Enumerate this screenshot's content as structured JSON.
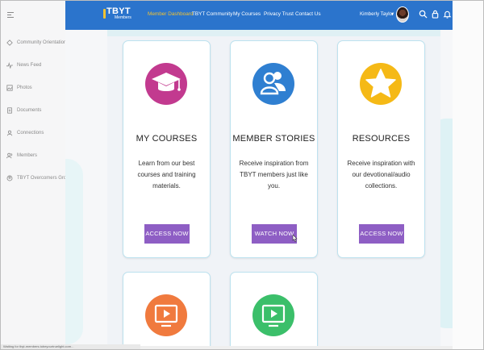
{
  "brand": {
    "name": "TBYT",
    "subtitle": "Members",
    "accent": "#f1c232"
  },
  "topbar": {
    "color": "#2b74cc",
    "nav": [
      {
        "label": "Member Dashboard",
        "active": true
      },
      {
        "label": "TBYT Community"
      },
      {
        "label": "My Courses"
      },
      {
        "label": "Privacy Trust"
      },
      {
        "label": "Contact Us"
      }
    ],
    "user_name": "Kimberly Taylor",
    "icons": [
      "search-icon",
      "lock-icon",
      "bell-icon"
    ]
  },
  "sidebar": {
    "items": [
      {
        "label": "Community Orientation",
        "icon": "community-icon"
      },
      {
        "label": "News Feed",
        "icon": "activity-icon"
      },
      {
        "label": "Photos",
        "icon": "photo-icon"
      },
      {
        "label": "Documents",
        "icon": "document-icon"
      },
      {
        "label": "Connections",
        "icon": "user-icon"
      },
      {
        "label": "Members",
        "icon": "members-icon"
      },
      {
        "label": "TBYT Overcomers Group",
        "icon": "group-icon"
      }
    ]
  },
  "cards": [
    {
      "title": "MY COURSES",
      "desc": "Learn from our best courses and training materials.",
      "button": "ACCESS NOW",
      "icon": "graduation-cap-icon",
      "color": "#c23a8f"
    },
    {
      "title": "MEMBER STORIES",
      "desc": "Receive inspiration from TBYT members just like you.",
      "button": "WATCH NOW",
      "icon": "people-icon",
      "color": "#2f7fd1"
    },
    {
      "title": "RESOURCES",
      "desc": "Receive inspiration with our devotional/audio collections.",
      "button": "ACCESS NOW",
      "icon": "star-icon",
      "color": "#f5b916"
    },
    {
      "title": "",
      "icon": "video-icon",
      "color": "#f07a3e"
    },
    {
      "title": "",
      "icon": "video-icon",
      "color": "#3bbf6a"
    }
  ],
  "button_color": "#8e5ec4",
  "status_bar": "Waiting for tbyt-members.tobeyourtruelight.com..."
}
